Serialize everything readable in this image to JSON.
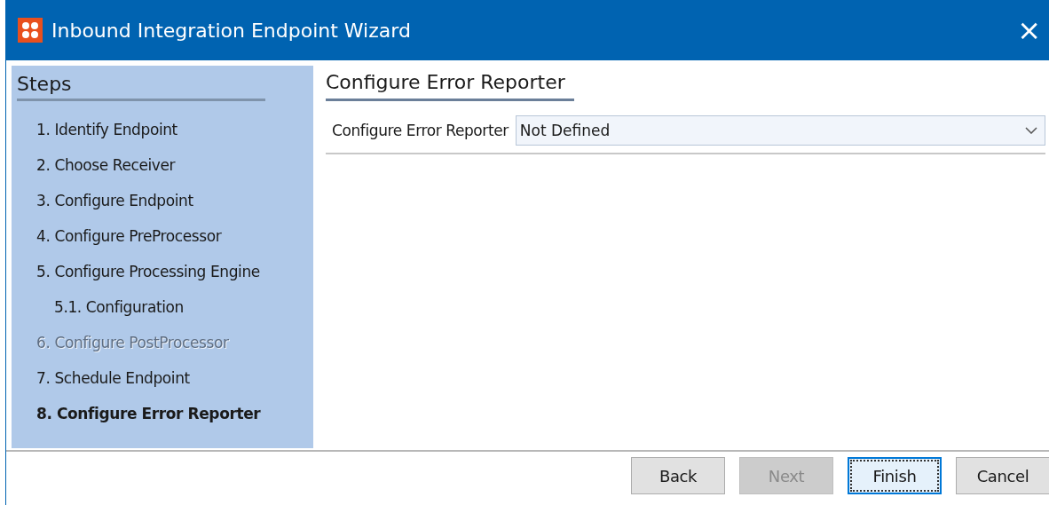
{
  "window": {
    "title": "Inbound Integration Endpoint Wizard",
    "close": "×"
  },
  "steps": {
    "title": "Steps",
    "items": [
      {
        "label": "1. Identify Endpoint",
        "selected": false,
        "disabled": false
      },
      {
        "label": "2. Choose Receiver",
        "selected": false,
        "disabled": false
      },
      {
        "label": "3. Configure Endpoint",
        "selected": false,
        "disabled": false
      },
      {
        "label": "4. Configure PreProcessor",
        "selected": false,
        "disabled": false
      },
      {
        "label": "5. Configure Processing Engine",
        "selected": false,
        "disabled": false,
        "children": [
          {
            "label": "5.1. Configuration",
            "selected": false,
            "disabled": false
          }
        ]
      },
      {
        "label": "6. Configure PostProcessor",
        "selected": false,
        "disabled": true
      },
      {
        "label": "7. Schedule Endpoint",
        "selected": false,
        "disabled": false
      },
      {
        "label": "8. Configure Error Reporter",
        "selected": true,
        "disabled": false
      }
    ]
  },
  "page": {
    "title": "Configure Error Reporter",
    "field": {
      "label": "Configure Error Reporter",
      "value": "Not Defined"
    }
  },
  "buttons": [
    {
      "label": "Back",
      "disabled": false,
      "focused": false
    },
    {
      "label": "Next",
      "disabled": true,
      "focused": false
    },
    {
      "label": "Finish",
      "disabled": false,
      "focused": true
    },
    {
      "label": "Cancel",
      "disabled": false,
      "focused": false
    }
  ]
}
